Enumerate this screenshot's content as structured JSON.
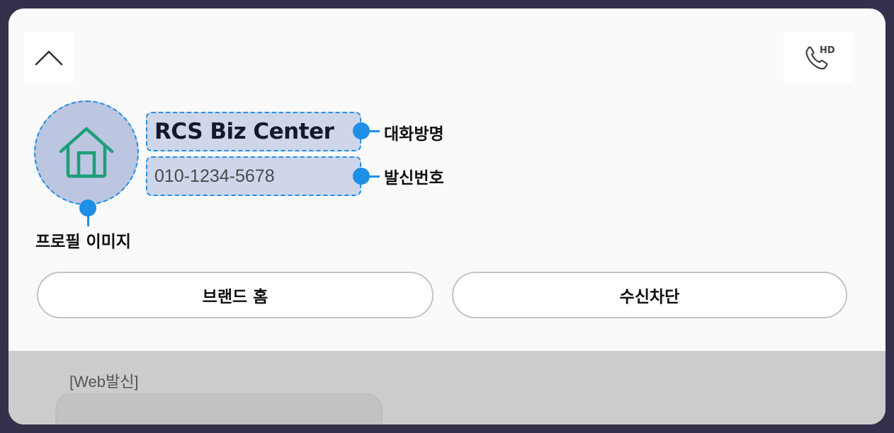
{
  "header": {
    "collapse_icon": "chevron-up-icon",
    "hd_call_icon": "hd-phone-icon",
    "hd_badge": "HD"
  },
  "profile": {
    "avatar_icon": "home-icon",
    "chat_name": "RCS Biz Center",
    "sender_number": "010-1234-5678"
  },
  "annotations": {
    "chat_name_label": "대화방명",
    "sender_number_label": "발신번호",
    "profile_image_label": "프로필 이미지"
  },
  "actions": {
    "brand_home_label": "브랜드 홈",
    "block_label": "수신차단"
  },
  "chat": {
    "web_send_label": "[Web발신]"
  },
  "colors": {
    "frame": "#342f4a",
    "annotation_blue": "#1e8fe6",
    "avatar_bg": "#bcc6e0",
    "home_icon": "#1e9e7a"
  }
}
